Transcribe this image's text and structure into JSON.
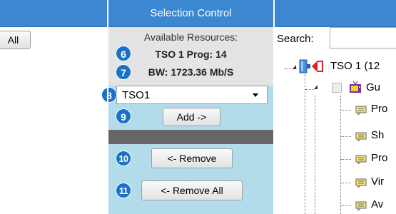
{
  "header": {
    "title": "Selection Control"
  },
  "left": {
    "button_label": "All"
  },
  "resources": {
    "title": "Available Resources:",
    "prog": "TSO 1 Prog: 14",
    "bw": "BW: 1723.36 Mb/S"
  },
  "select": {
    "value": "TSO1"
  },
  "buttons": {
    "add": "Add ->",
    "remove": "<- Remove",
    "remove_all": "<- Remove All"
  },
  "badges": {
    "b6": "6",
    "b7": "7",
    "b8": "8",
    "b9": "9",
    "b10": "10",
    "b11": "11"
  },
  "search": {
    "label": "Search:"
  },
  "tree": {
    "root": "TSO 1 (12",
    "items": [
      "Gu",
      "Pro",
      "Sh",
      "Pro",
      "Vir",
      "Av"
    ]
  },
  "colors": {
    "header_blue": "#3d87d2",
    "panel_light": "#b3dceb",
    "panel_gray": "#e4e4e4",
    "badge": "#1a72c8",
    "dark_band": "#666666"
  }
}
